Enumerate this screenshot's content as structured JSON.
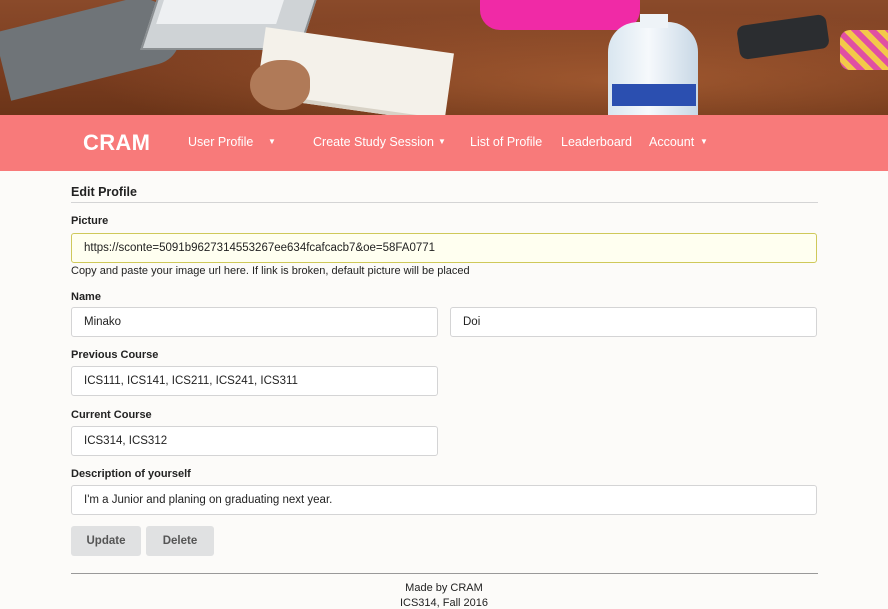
{
  "navbar": {
    "brand": "CRAM",
    "items": [
      {
        "label": "User Profile",
        "dropdown": true
      },
      {
        "label": "Create Study Session",
        "dropdown": true
      },
      {
        "label": "List of Profile",
        "dropdown": false
      },
      {
        "label": "Leaderboard",
        "dropdown": false
      },
      {
        "label": "Account",
        "dropdown": true
      }
    ],
    "background_color": "#f87a7a"
  },
  "form": {
    "title": "Edit Profile",
    "picture": {
      "label": "Picture",
      "value": "https://sconte=5091b9627314553267ee634fcafcacb7&oe=58FA0771",
      "help": "Copy and paste your image url here. If link is broken, default picture will be placed"
    },
    "name": {
      "label": "Name",
      "first": "Minako",
      "last": "Doi"
    },
    "previous_course": {
      "label": "Previous Course",
      "value": "ICS111, ICS141, ICS211, ICS241, ICS311"
    },
    "current_course": {
      "label": "Current Course",
      "value": "ICS314, ICS312"
    },
    "description": {
      "label": "Description of yourself",
      "value": "I'm a Junior and planing on graduating next year."
    },
    "buttons": {
      "update": "Update",
      "delete": "Delete"
    }
  },
  "footer": {
    "line1": "Made by CRAM",
    "line2": "ICS314, Fall 2016"
  }
}
